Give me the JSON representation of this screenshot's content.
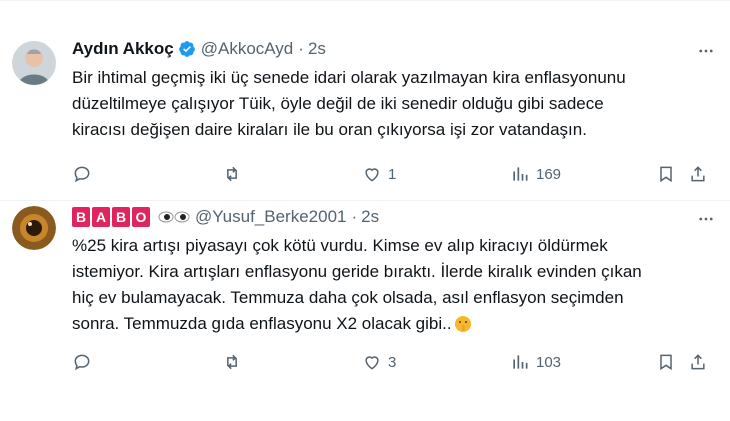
{
  "colors": {
    "accent": "#1d9bf0",
    "secondary_text": "#536471",
    "babo_box": "#e0245e"
  },
  "tweets": [
    {
      "author_name": "Aydın Akkoç",
      "verified": true,
      "handle": "@AkkocAyd",
      "separator": "·",
      "time": "2s",
      "text_lines": [
        "Bir ihtimal geçmiş iki üç senede idari olarak yazılmayan kira enflasyonunu",
        "düzeltilmeye çalışıyor Tüik, öyle değil de iki senedir olduğu gibi sadece",
        "kiracısı değişen daire kiraları ile bu oran çıkıyorsa işi zor vatandaşın."
      ],
      "likes": "1",
      "views": "169"
    },
    {
      "author_letters": [
        "B",
        "A",
        "B",
        "O"
      ],
      "handle": "@Yusuf_Berke2001",
      "separator": "·",
      "time": "2s",
      "text_lines": [
        "%25 kira artışı piyasayı çok kötü vurdu. Kimse ev alıp kiracıyı öldürmek",
        "istemiyor.  Kira artışları enflasyonu geride bıraktı. İlerde kiralık evinden çıkan",
        "hiç ev bulamayacak. Temmuza daha çok olsada, asıl enflasyon seçimden",
        "sonra. Temmuzda gıda enflasyonu X2 olacak gibi.."
      ],
      "likes": "3",
      "views": "103"
    }
  ]
}
